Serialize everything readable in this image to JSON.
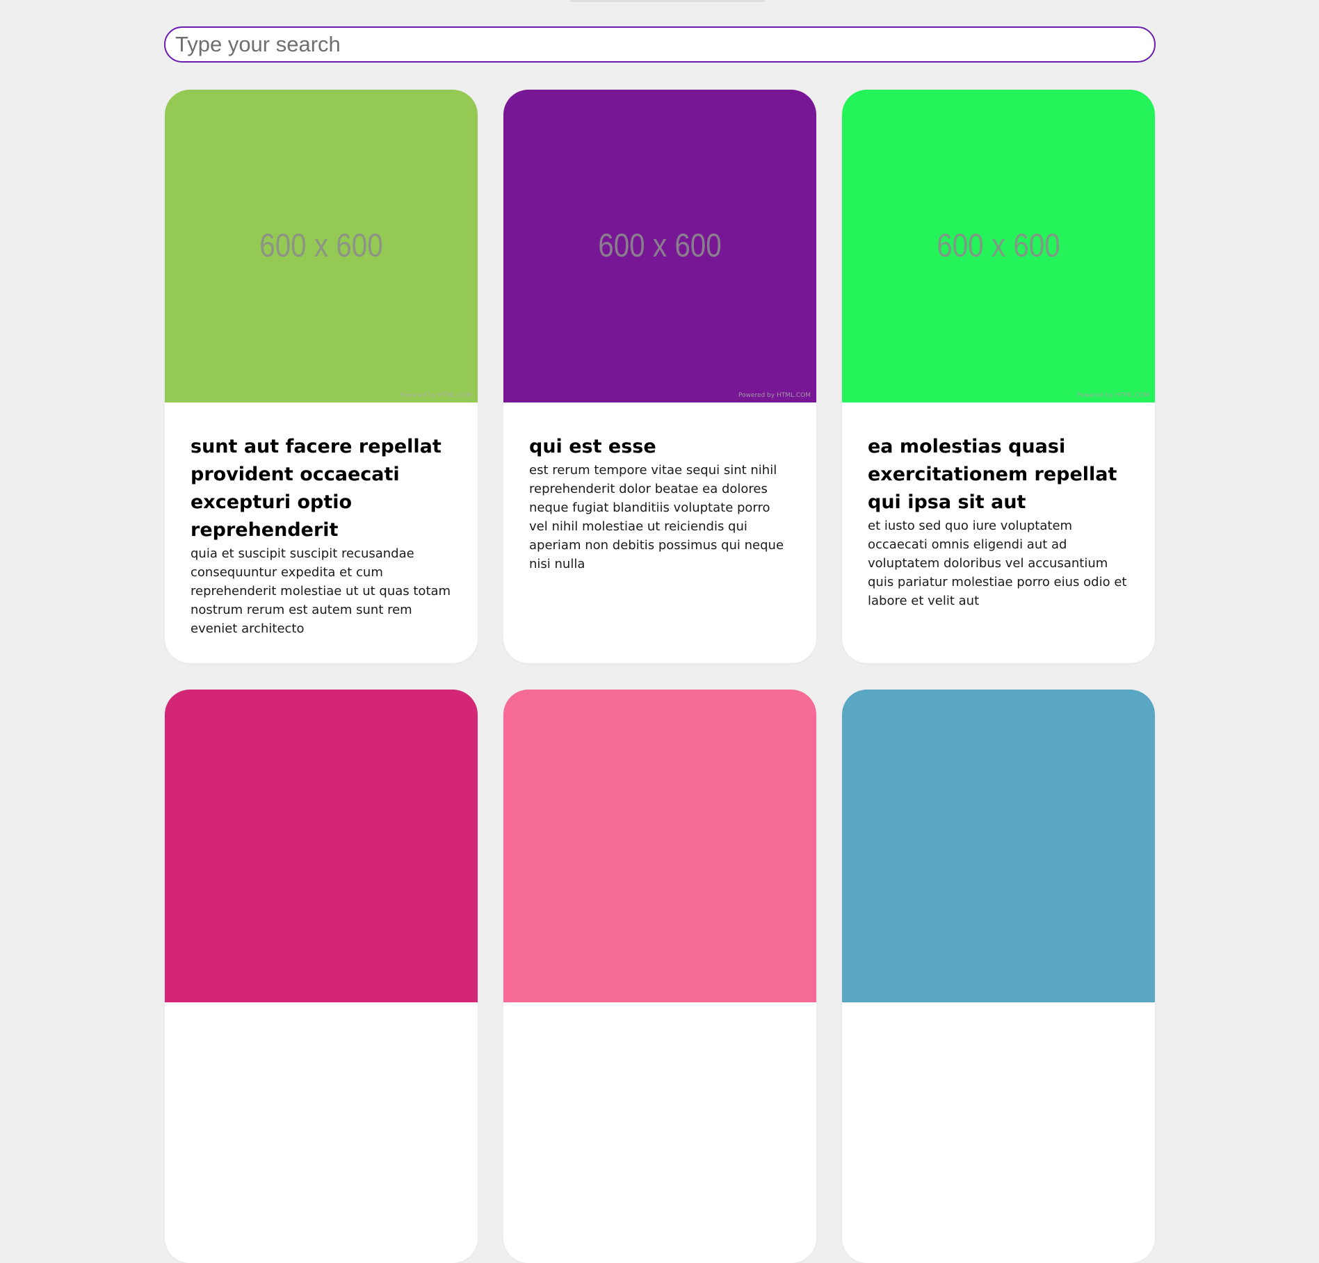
{
  "search": {
    "placeholder": "Type your search",
    "value": ""
  },
  "colors": {
    "search_border": "#6a1bb0",
    "background": "#efefef",
    "card_background": "#ffffff"
  },
  "cards": [
    {
      "image_label": "600 x 600",
      "image_credit": "Powered by HTML.COM",
      "image_color": "#94ca54",
      "title": "sunt aut facere repellat provident occaecati excepturi optio reprehenderit",
      "body": "quia et suscipit suscipit recusandae consequuntur expedita et cum reprehenderit molestiae ut ut quas totam nostrum rerum est autem sunt rem eveniet architecto"
    },
    {
      "image_label": "600 x 600",
      "image_credit": "Powered by HTML.COM",
      "image_color": "#781795",
      "title": "qui est esse",
      "body": "est rerum tempore vitae sequi sint nihil reprehenderit dolor beatae ea dolores neque fugiat blanditiis voluptate porro vel nihil molestiae ut reiciendis qui aperiam non debitis possimus qui neque nisi nulla"
    },
    {
      "image_label": "600 x 600",
      "image_credit": "Powered by HTML.COM",
      "image_color": "#24f35a",
      "title": "ea molestias quasi exercitationem repellat qui ipsa sit aut",
      "body": "et iusto sed quo iure voluptatem occaecati omnis eligendi aut ad voluptatem doloribus vel accusantium quis pariatur molestiae porro eius odio et labore et velit aut"
    },
    {
      "image_color": "#d32677"
    },
    {
      "image_color": "#f66b96"
    },
    {
      "image_color": "#59a7c3"
    }
  ]
}
